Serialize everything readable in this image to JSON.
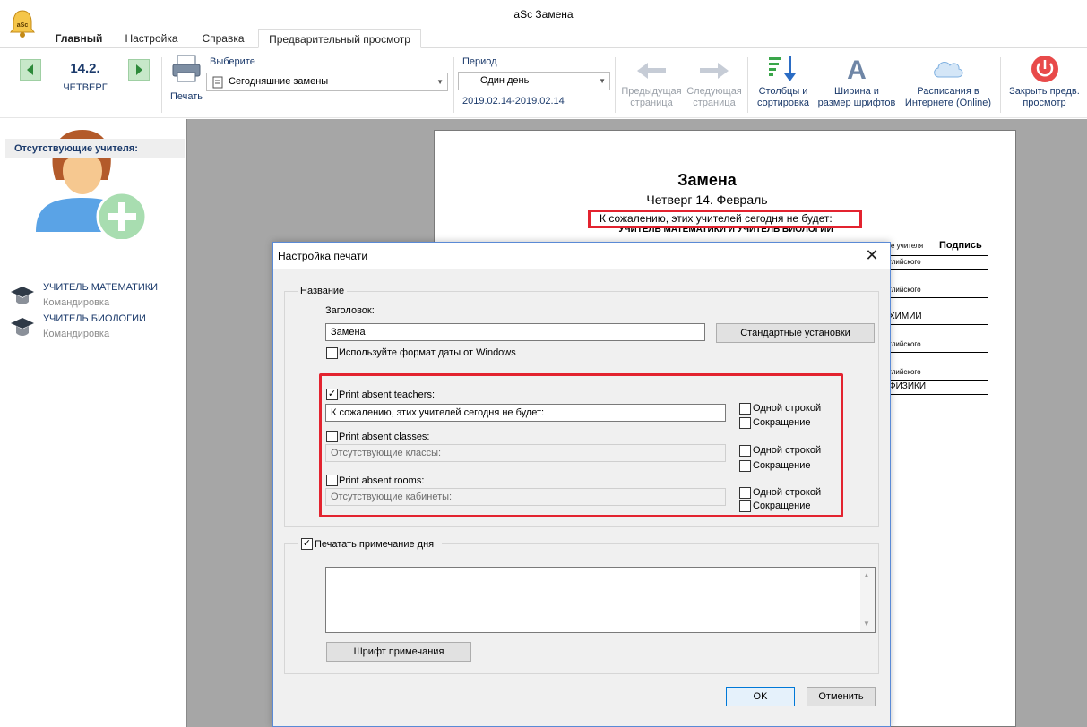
{
  "app": {
    "title": "aSc Замена"
  },
  "tabs": [
    {
      "label": "Главный"
    },
    {
      "label": "Настройка"
    },
    {
      "label": "Справка"
    },
    {
      "label": "Предварительный просмотр"
    }
  ],
  "ribbon": {
    "date": "14.2.",
    "day": "ЧЕТВЕРГ",
    "print_label": "Печать",
    "select_label": "Выберите",
    "select_value": "Сегодняшние замены",
    "period_label": "Период",
    "period_value": "Один день",
    "period_range": "2019.02.14-2019.02.14",
    "prev_page": [
      "Предыдущая",
      "страница"
    ],
    "next_page": [
      "Следующая",
      "страница"
    ],
    "columns": [
      "Столбцы и",
      "сортировка"
    ],
    "width": [
      "Ширина и",
      "размер шрифтов"
    ],
    "online": [
      "Расписания в",
      "Интернете (Online)"
    ],
    "close_preview": [
      "Закрыть предв.",
      "просмотр"
    ]
  },
  "left": {
    "absent_header": "Отсутствующие учителя:",
    "teachers": [
      {
        "name": "УЧИТЕЛЬ МАТЕМАТИКИ",
        "reason": "Командировка"
      },
      {
        "name": "УЧИТЕЛЬ БИОЛОГИИ",
        "reason": "Командировка"
      }
    ]
  },
  "preview": {
    "title": "Замена",
    "date": "Четверг 14. Февраль",
    "absent_text": "К сожалению, этих учителей сегодня не будет:",
    "absent_list": "УЧИТЕЛЬ МАТЕМАТИКИ И УЧИТЕЛЬ БИОЛОГИИ",
    "col_teacher": "е учителя",
    "col_sign": "Подпись",
    "rows": [
      "глийского",
      "глийского",
      "ХИМИИ",
      "глийского",
      "глийского",
      "ФИЗИКИ"
    ]
  },
  "dialog": {
    "title": "Настройка печати",
    "group_name": "Название",
    "header_label": "Заголовок:",
    "header_value": "Замена",
    "defaults_button": "Стандартные установки",
    "windows_date": "Используйте формат даты от Windows",
    "print_teachers": "Print absent teachers:",
    "teachers_value": "К сожалению, этих учителей сегодня не будет:",
    "print_classes": "Print absent classes:",
    "classes_value": "Отсутствующие классы:",
    "print_rooms": "Print absent rooms:",
    "rooms_value": "Отсутствующие  кабинеты:",
    "one_line": "Одной строкой",
    "abbrev": "Сокращение",
    "print_note": "Печатать примечание дня",
    "note_font": "Шрифт примечания",
    "ok": "OK",
    "cancel": "Отменить"
  },
  "colors": {
    "accent_red": "#e3232f",
    "nav_text": "#1b3a6b",
    "arrow_green": "#c7e8c9"
  }
}
